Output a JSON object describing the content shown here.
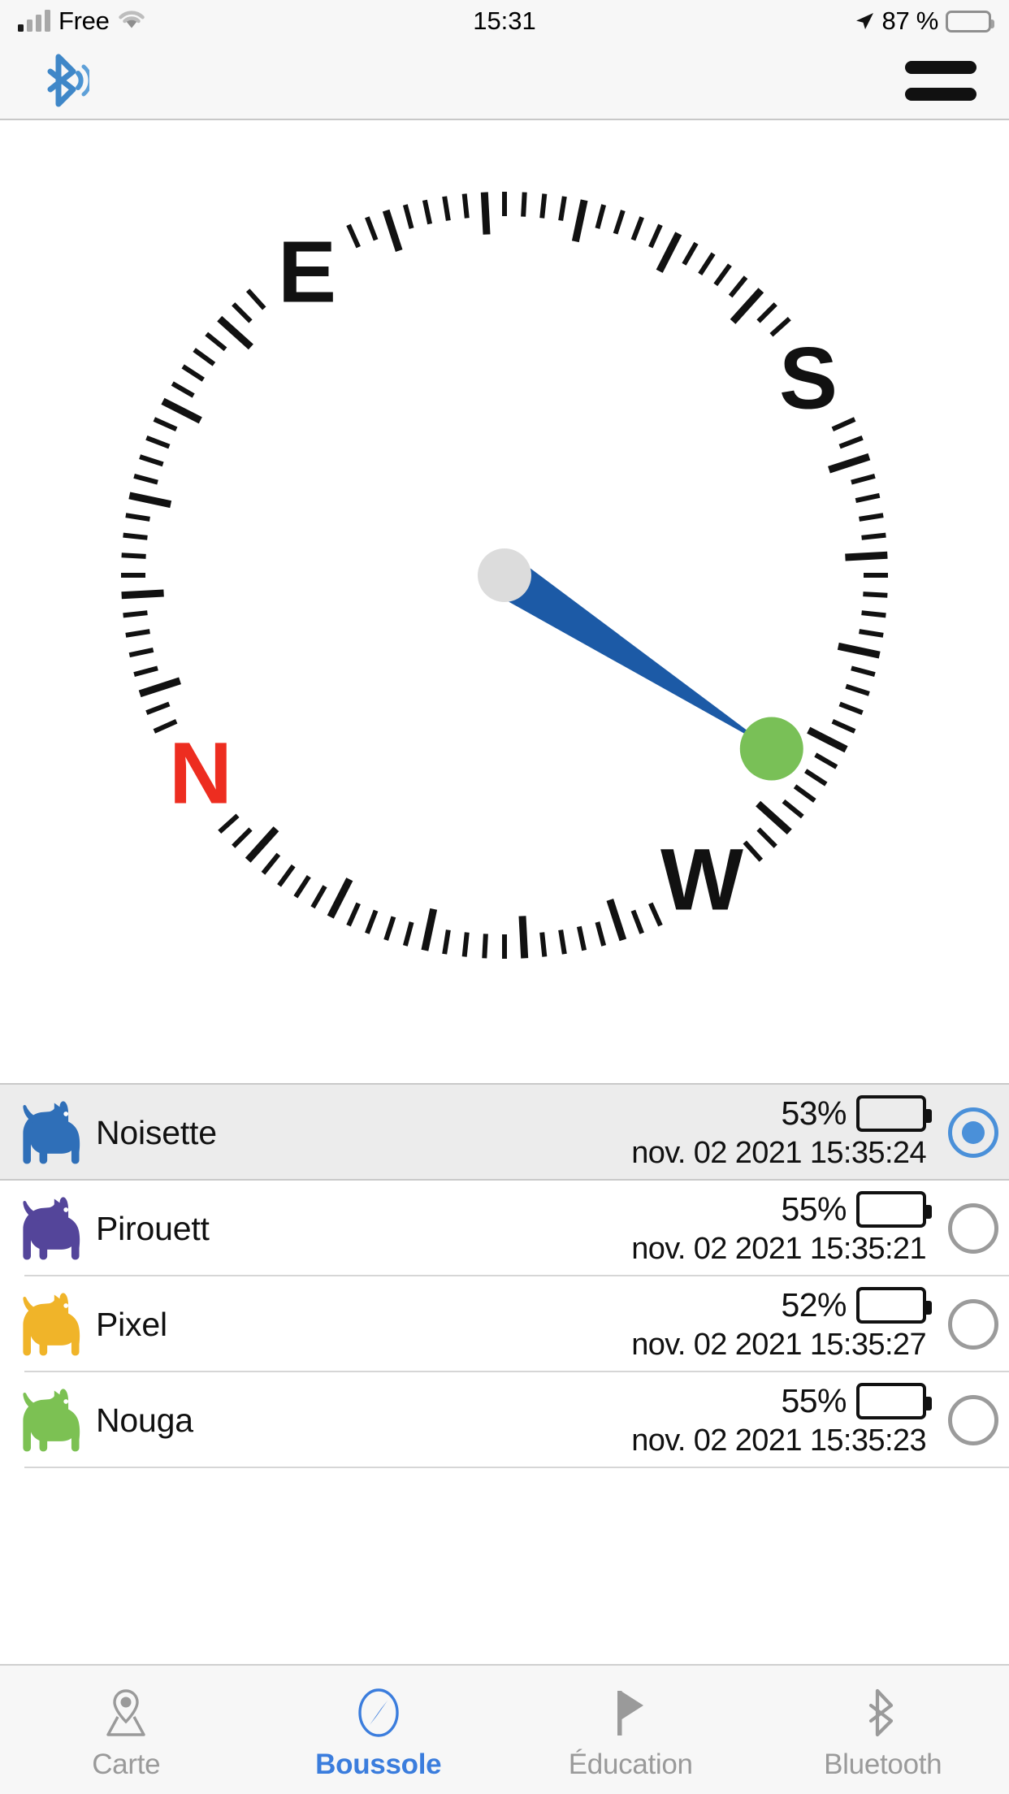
{
  "status_bar": {
    "carrier": "Free",
    "signal_icon": "cellular-bars-icon",
    "wifi_icon": "wifi-icon",
    "time": "15:31",
    "location_icon": "location-arrow-icon",
    "battery_percent": "87 %",
    "battery_level": 87,
    "battery_icon": "battery-icon"
  },
  "nav_bar": {
    "bluetooth_icon": "bluetooth-connected-icon",
    "menu_icon": "hamburger-menu-icon"
  },
  "compass": {
    "heading_degrees": 123,
    "cardinals": [
      {
        "label": "N",
        "color": "#ed2d20",
        "angle": 0
      },
      {
        "label": "E",
        "color": "#111111",
        "angle": 90
      },
      {
        "label": "S",
        "color": "#111111",
        "angle": 180
      },
      {
        "label": "W",
        "color": "#111111",
        "angle": 270
      }
    ],
    "needle_color": "#1c5aa6",
    "hub_color": "#dcdcdc",
    "target_color": "#79c057",
    "needle_angle": 123,
    "tick_color": "#111111"
  },
  "devices": {
    "columns": [
      "name",
      "battery",
      "timestamp"
    ],
    "rows": [
      {
        "icon": "dog-icon",
        "color": "#2f6fb8",
        "name": "Noisette",
        "battery_label": "53%",
        "battery_level": 53,
        "timestamp": "nov. 02 2021 15:35:24",
        "selected": true
      },
      {
        "icon": "dog-icon",
        "color": "#54459a",
        "name": "Pirouett",
        "battery_label": "55%",
        "battery_level": 55,
        "timestamp": "nov. 02 2021 15:35:21",
        "selected": false
      },
      {
        "icon": "dog-icon",
        "color": "#f0b429",
        "name": "Pixel",
        "battery_label": "52%",
        "battery_level": 52,
        "timestamp": "nov. 02 2021 15:35:27",
        "selected": false
      },
      {
        "icon": "dog-icon",
        "color": "#7cc153",
        "name": "Nouga",
        "battery_label": "55%",
        "battery_level": 55,
        "timestamp": "nov. 02 2021 15:35:23",
        "selected": false
      }
    ]
  },
  "tab_bar": {
    "active_color": "#3b7ddd",
    "inactive_color": "#9a9a9a",
    "tabs": [
      {
        "label": "Carte",
        "icon": "map-pin-icon",
        "active": false
      },
      {
        "label": "Boussole",
        "icon": "compass-icon",
        "active": true
      },
      {
        "label": "Éducation",
        "icon": "flag-icon",
        "active": false
      },
      {
        "label": "Bluetooth",
        "icon": "bluetooth-icon",
        "active": false
      }
    ]
  }
}
